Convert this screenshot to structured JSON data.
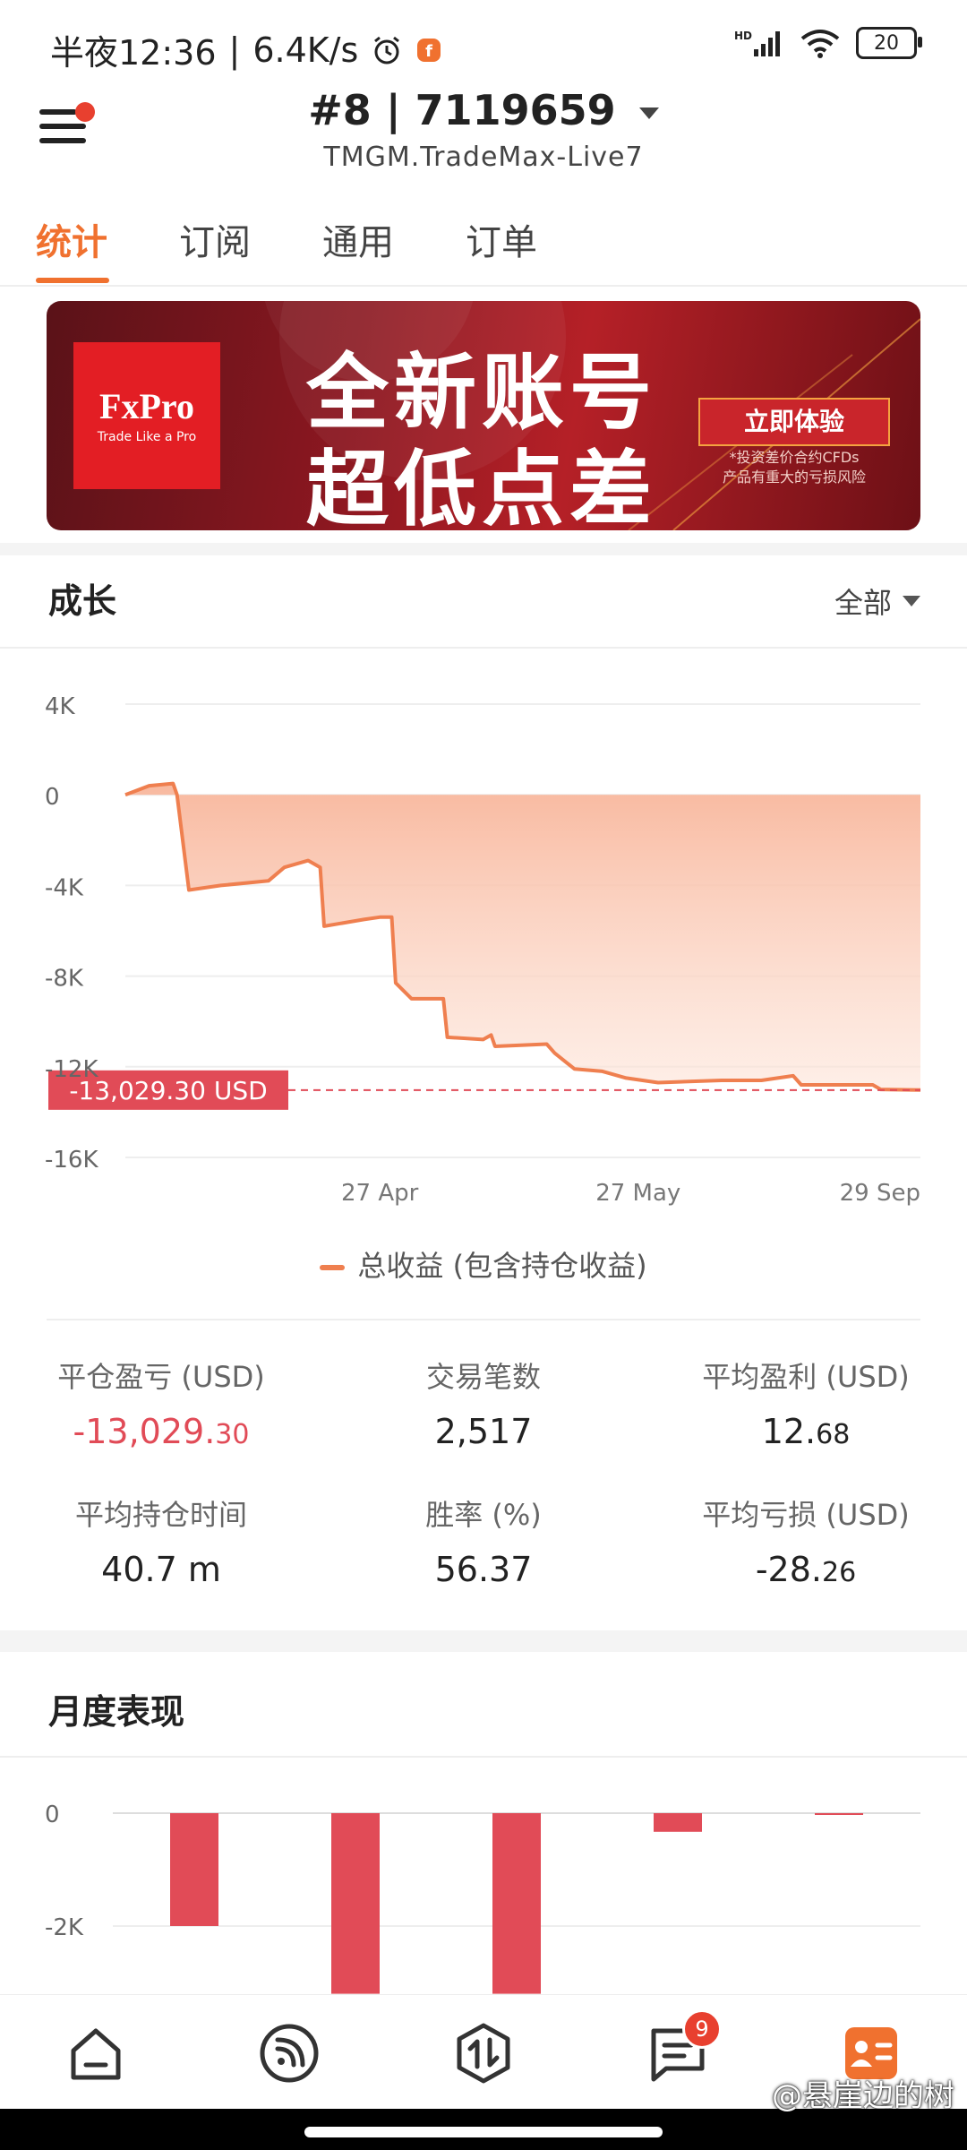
{
  "status_bar": {
    "time": "半夜12:36",
    "speed": "6.4K/s",
    "network": "HD",
    "battery": "20"
  },
  "header": {
    "account_title": "#8 | 7119659",
    "server": "TMGM.TradeMax-Live7"
  },
  "tabs": [
    {
      "label": "统计",
      "active": true
    },
    {
      "label": "订阅",
      "active": false
    },
    {
      "label": "通用",
      "active": false
    },
    {
      "label": "订单",
      "active": false
    }
  ],
  "banner": {
    "brand": "FxPro",
    "tagline": "Trade Like a Pro",
    "line1": "全新账号",
    "line2": "超低点差",
    "cta": "立即体验",
    "disclaimer_1": "*投资差价合约CFDs",
    "disclaimer_2": "产品有重大的亏损风险"
  },
  "growth": {
    "title": "成长",
    "filter": "全部",
    "current_label": "-13,029.30 USD",
    "legend": "总收益 (包含持仓收益)"
  },
  "chart_data": {
    "type": "area",
    "title": "成长",
    "y_ticks": [
      "4K",
      "0",
      "-4K",
      "-8K",
      "-12K",
      "-16K"
    ],
    "ylim": [
      -16000,
      4000
    ],
    "x_ticks": [
      {
        "label": "27 Apr",
        "t": 0.32
      },
      {
        "label": "27 May",
        "t": 0.645
      },
      {
        "label": "29 Sep",
        "t": 1.0
      }
    ],
    "series": [
      {
        "name": "总收益 (包含持仓收益)",
        "color": "#ef7f4f",
        "points": [
          [
            0.0,
            0
          ],
          [
            0.03,
            400
          ],
          [
            0.06,
            500
          ],
          [
            0.065,
            0
          ],
          [
            0.08,
            -4200
          ],
          [
            0.12,
            -4000
          ],
          [
            0.18,
            -3800
          ],
          [
            0.2,
            -3200
          ],
          [
            0.23,
            -2900
          ],
          [
            0.245,
            -3200
          ],
          [
            0.25,
            -5800
          ],
          [
            0.3,
            -5500
          ],
          [
            0.32,
            -5400
          ],
          [
            0.335,
            -5400
          ],
          [
            0.34,
            -8300
          ],
          [
            0.36,
            -9000
          ],
          [
            0.4,
            -9000
          ],
          [
            0.405,
            -10700
          ],
          [
            0.45,
            -10800
          ],
          [
            0.46,
            -10600
          ],
          [
            0.465,
            -11100
          ],
          [
            0.53,
            -11000
          ],
          [
            0.54,
            -11400
          ],
          [
            0.565,
            -12100
          ],
          [
            0.6,
            -12200
          ],
          [
            0.63,
            -12500
          ],
          [
            0.67,
            -12700
          ],
          [
            0.75,
            -12600
          ],
          [
            0.8,
            -12600
          ],
          [
            0.84,
            -12400
          ],
          [
            0.85,
            -12800
          ],
          [
            0.94,
            -12800
          ],
          [
            0.95,
            -13000
          ],
          [
            1.0,
            -13029.3
          ]
        ]
      }
    ],
    "reference_value": -13029.3
  },
  "stats": [
    {
      "label": "平仓盈亏 (USD)",
      "value": "-13,029.",
      "value_small": "30",
      "negative": true
    },
    {
      "label": "交易笔数",
      "value": "2,517",
      "value_small": "",
      "negative": false
    },
    {
      "label": "平均盈利 (USD)",
      "value": "12.",
      "value_small": "68",
      "negative": false
    },
    {
      "label": "平均持仓时间",
      "value": "40.7 m",
      "value_small": "",
      "negative": false
    },
    {
      "label": "胜率 (%)",
      "value": "56.37",
      "value_small": "",
      "negative": false
    },
    {
      "label": "平均亏损 (USD)",
      "value": "-28.",
      "value_small": "26",
      "negative": false
    }
  ],
  "monthly": {
    "title": "月度表现",
    "y_ticks": [
      "0",
      "-2K"
    ]
  },
  "monthly_chart_data": {
    "type": "bar",
    "color": "#e14b57",
    "values": [
      -2000,
      -3200,
      -3200,
      -330,
      -20
    ]
  },
  "nav": {
    "badge": "9"
  },
  "watermark": "@悬崖边的树"
}
